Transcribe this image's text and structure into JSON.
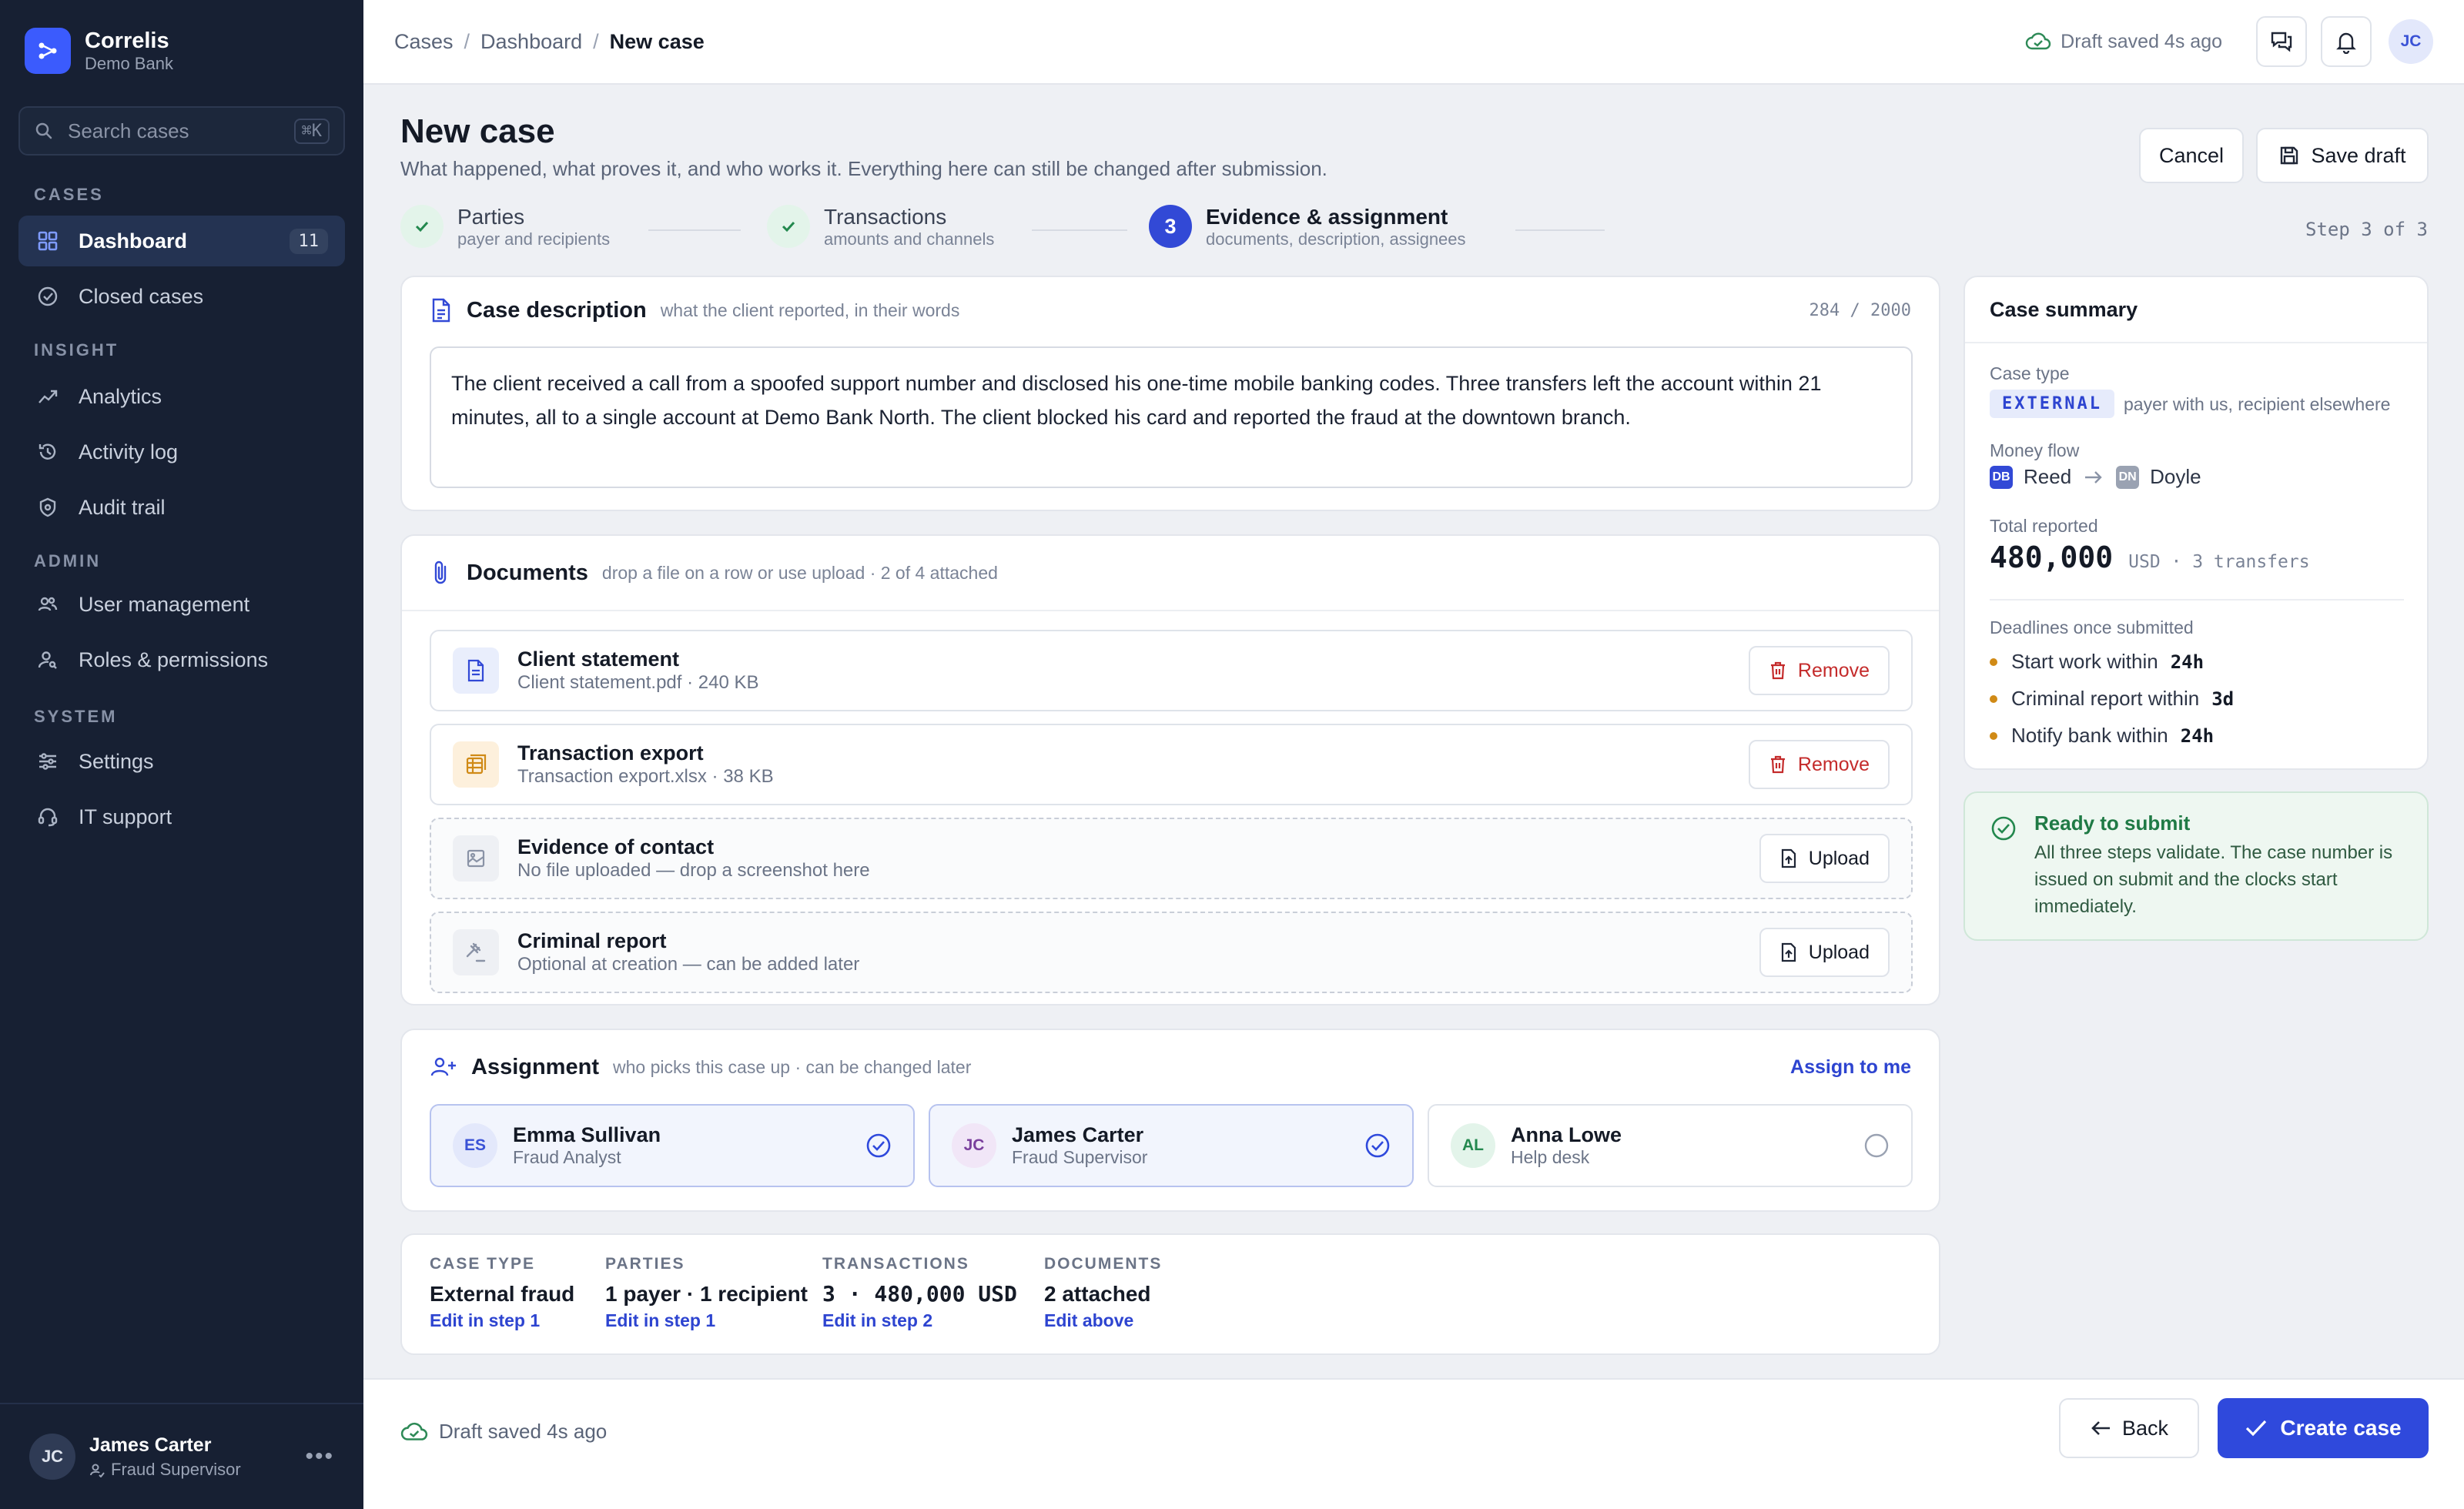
{
  "brand": {
    "name": "Correlis",
    "subtitle": "Demo Bank"
  },
  "search": {
    "placeholder": "Search cases",
    "shortcut": "⌘K"
  },
  "sidebar": {
    "sections": {
      "cases": "CASES",
      "insight": "INSIGHT",
      "admin": "ADMIN",
      "system": "SYSTEM"
    },
    "items": [
      {
        "label": "Dashboard",
        "icon": "grid-icon",
        "badge": "11",
        "active": true
      },
      {
        "label": "Closed cases",
        "icon": "check-circle-icon"
      },
      {
        "label": "Analytics",
        "icon": "trend-icon"
      },
      {
        "label": "Activity log",
        "icon": "history-icon"
      },
      {
        "label": "Audit trail",
        "icon": "shield-icon"
      },
      {
        "label": "User management",
        "icon": "users-icon"
      },
      {
        "label": "Roles & permissions",
        "icon": "user-key-icon"
      },
      {
        "label": "Settings",
        "icon": "sliders-icon"
      },
      {
        "label": "IT support",
        "icon": "headset-icon"
      }
    ],
    "user": {
      "initials": "JC",
      "name": "James Carter",
      "role": "Fraud Supervisor",
      "more": "•••"
    }
  },
  "topbar": {
    "breadcrumbs": [
      "Cases",
      "Dashboard",
      "New case"
    ],
    "separator": "/",
    "saved_status": "Draft saved 4s ago",
    "avatar": "JC"
  },
  "page": {
    "title": "New case",
    "subtitle": "What happened, what proves it, and who works it. Everything here can still be changed after submission.",
    "cancel_label": "Cancel",
    "save_draft_label": "Save draft"
  },
  "steps": [
    {
      "label": "Parties",
      "sub": "payer and recipients",
      "status": "done"
    },
    {
      "label": "Transactions",
      "sub": "amounts and channels",
      "status": "done"
    },
    {
      "number": "3",
      "label": "Evidence & assignment",
      "sub": "documents, description, assignees",
      "status": "current"
    }
  ],
  "step_counter": "Step 3 of 3",
  "description": {
    "title": "Case description",
    "hint": "what the client reported, in their words",
    "count": "284 / 2000",
    "text": "The client received a call from a spoofed support number and disclosed his one-time mobile banking codes. Three transfers left the account within 21 minutes, all to a single account at Demo Bank North. The client blocked his card and reported the fraud at the downtown branch."
  },
  "documents": {
    "title": "Documents",
    "hint": "drop a file on a row or use upload · 2 of 4 attached",
    "rows": [
      {
        "name": "Client statement",
        "meta": "Client statement.pdf · 240 KB",
        "action": "Remove",
        "icon": "document-icon"
      },
      {
        "name": "Transaction export",
        "meta": "Transaction export.xlsx · 38 KB",
        "action": "Remove",
        "icon": "spreadsheet-icon"
      },
      {
        "name": "Evidence of contact",
        "meta": "No file uploaded — drop a screenshot here",
        "action": "Upload",
        "icon": "image-icon"
      },
      {
        "name": "Criminal report",
        "meta": "Optional at creation — can be added later",
        "action": "Upload",
        "icon": "gavel-icon"
      }
    ]
  },
  "assignment": {
    "title": "Assignment",
    "hint": "who picks this case up · can be changed later",
    "assign_me": "Assign to me",
    "people": [
      {
        "initials": "ES",
        "name": "Emma Sullivan",
        "role": "Fraud Analyst",
        "selected": true
      },
      {
        "initials": "JC",
        "name": "James Carter",
        "role": "Fraud Supervisor",
        "selected": true
      },
      {
        "initials": "AL",
        "name": "Anna Lowe",
        "role": "Help desk",
        "selected": false
      }
    ]
  },
  "review": [
    {
      "label": "CASE TYPE",
      "value": "External fraud",
      "link": "Edit in step 1"
    },
    {
      "label": "PARTIES",
      "value": "1 payer · 1 recipient",
      "link": "Edit in step 1"
    },
    {
      "label": "TRANSACTIONS",
      "value": "3 · 480,000 USD",
      "link": "Edit in step 2"
    },
    {
      "label": "DOCUMENTS",
      "value": "2 attached",
      "link": "Edit above"
    }
  ],
  "summary": {
    "title": "Case summary",
    "case_type_label": "Case type",
    "case_type": "EXTERNAL",
    "case_type_note": "payer with us, recipient elsewhere",
    "money_flow_label": "Money flow",
    "from": {
      "initials": "DB",
      "name": "Reed"
    },
    "to": {
      "initials": "DN",
      "name": "Doyle"
    },
    "total_label": "Total reported",
    "total": "480,000",
    "total_unit": "USD · 3 transfers",
    "deadlines_label": "Deadlines once submitted",
    "deadlines": [
      {
        "label": "Start work within",
        "value": "24h"
      },
      {
        "label": "Criminal report within",
        "value": "3d"
      },
      {
        "label": "Notify bank within",
        "value": "24h"
      }
    ]
  },
  "ready": {
    "title": "Ready to submit",
    "text": "All three steps validate. The case number is issued on submit and the clocks start immediately."
  },
  "footer": {
    "saved": "Draft saved 4s ago",
    "back_label": "Back",
    "create_label": "Create case"
  },
  "colors": {
    "accent": "#2f49dc",
    "sidebar": "#172033",
    "success": "#1f7a45",
    "danger": "#c42b2b",
    "deadline_dot": "#d08a16"
  }
}
